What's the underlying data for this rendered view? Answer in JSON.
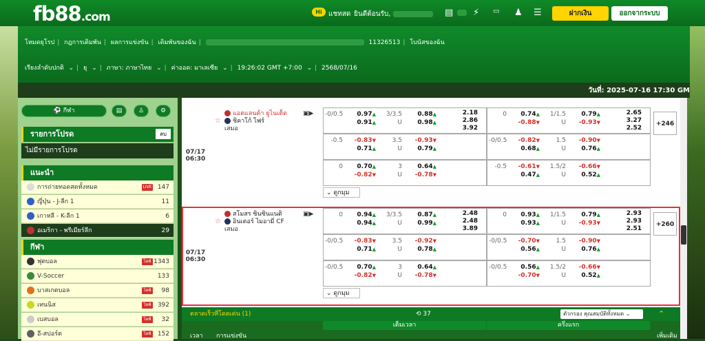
{
  "topbar": {
    "logo_main": "fb88",
    "logo_suffix": ".com",
    "hi_badge": "Hi",
    "chat_label": "แชทสด",
    "welcome_label": "ยินดีต้อนรับ,",
    "deposit_button": "ฝากเงิน",
    "logout_button": "ออกจากระบบ"
  },
  "menu": {
    "row1": [
      "โหมดยุโรป",
      "กฎการเดิมพัน",
      "ผลการแข่งขัน",
      "เดิมพันของฉัน"
    ],
    "account_id": "11326513",
    "bonus_label": "โบนัสของฉัน",
    "sort_label": "เรียงลำดับปกติ",
    "odds_type": "ยุ",
    "language": "ภาษา: ภาษาไทย",
    "odds_format": "ค่าออด: มาเลเซีย",
    "timezone": "19:26:02 GMT +7:00",
    "date": "2568/07/16"
  },
  "datetime": "วันที่: 2025-07-16 17:30 GM",
  "sidebar": {
    "sports_button": "กีฬา",
    "favorites_title": "รายการโปรด",
    "favorites_btn": "ลบ",
    "no_favorites": "ไม่มีรายการโปรด",
    "recommended_title": "แนะนำ",
    "recommended": [
      {
        "label": "การถ่ายทอดสดทั้งหมด",
        "count": "147",
        "live": "LIVE",
        "color": "#dddddd"
      },
      {
        "label": "ญี่ปุ่น - J-ลีก 1",
        "count": "11",
        "color": "#3060c0"
      },
      {
        "label": "เกาหลี - K-ลีก 1",
        "count": "6",
        "color": "#3060c0"
      },
      {
        "label": "อเมริกา - พรีเมียร์ลีก",
        "count": "29",
        "color": "#c03030",
        "selected": true
      }
    ],
    "sports_title": "กีฬา",
    "sports": [
      {
        "label": "ฟุตบอล",
        "count": "1343",
        "live": "ไลฟ์",
        "color": "#333333"
      },
      {
        "label": "V-Soccer",
        "count": "133",
        "color": "#3a8a3a"
      },
      {
        "label": "บาสเกตบอล",
        "count": "98",
        "live": "ไลฟ์",
        "color": "#e07020"
      },
      {
        "label": "เทนนิส",
        "count": "392",
        "live": "ไลฟ์",
        "color": "#c8d820"
      },
      {
        "label": "เบสบอล",
        "count": "32",
        "live": "ไลฟ์",
        "color": "#cccccc"
      },
      {
        "label": "อี-สปอร์ต",
        "count": "152",
        "live": "ไลฟ์",
        "color": "#606060"
      }
    ]
  },
  "matches": [
    {
      "date": "07/17",
      "time": "06:30",
      "home": "แอตแลนต้า ยูไนเต็ด",
      "away": "ชิคาโก้ ไฟร์",
      "draw": "เสมอ",
      "more": "+246",
      "more_label": "ดูกมุม",
      "rows": [
        {
          "h_hdp": "-0/0.5",
          "h_o1": "0.97",
          "h_o2": "0.91",
          "ou_line": "3/3.5",
          "ou_u": "U",
          "ou_o1": "0.88",
          "ou_o2": "0.98",
          "x12": [
            "2.18",
            "2.86",
            "3.92"
          ],
          "f_hdp": "0",
          "f_o1": "0.74",
          "f_o2": "-0.88",
          "fou_line": "1/1.5",
          "fou_u": "U",
          "fou_o1": "0.79",
          "fou_o2": "-0.93",
          "fx12": [
            "2.65",
            "3.27",
            "2.52"
          ]
        },
        {
          "h_hdp": "-0.5",
          "h_o1": "-0.83",
          "h_o2": "0.71",
          "ou_line": "3.5",
          "ou_u": "U",
          "ou_o1": "-0.93",
          "ou_o2": "0.79",
          "f_hdp": "-0/0.5",
          "f_o1": "-0.82",
          "f_o2": "0.68",
          "fou_line": "1.5",
          "fou_u": "U",
          "fou_o1": "-0.90",
          "fou_o2": "0.76"
        },
        {
          "h_hdp": "0",
          "h_o1": "0.70",
          "h_o2": "-0.82",
          "ou_line": "3",
          "ou_u": "U",
          "ou_o1": "0.64",
          "ou_o2": "-0.78",
          "f_hdp": "-0.5",
          "f_o1": "-0.61",
          "f_o2": "0.47",
          "fou_line": "1.5/2",
          "fou_u": "U",
          "fou_o1": "-0.66",
          "fou_o2": "0.52"
        }
      ]
    },
    {
      "date": "07/17",
      "time": "06:30",
      "home": "สโมสร ซินซินแนติ",
      "away": "อินเตอร์ ไมอามี่ CF",
      "draw": "เสมอ",
      "more": "+260",
      "more_label": "ดูกมุม",
      "rows": [
        {
          "h_hdp": "0",
          "h_o1": "0.94",
          "h_o2": "0.94",
          "ou_line": "3/3.5",
          "ou_u": "U",
          "ou_o1": "0.87",
          "ou_o2": "0.99",
          "x12": [
            "2.48",
            "2.48",
            "3.89"
          ],
          "f_hdp": "0",
          "f_o1": "0.93",
          "f_o2": "0.93",
          "fou_line": "1/1.5",
          "fou_u": "U",
          "fou_o1": "0.79",
          "fou_o2": "-0.93",
          "fx12": [
            "2.93",
            "2.93",
            "2.51"
          ]
        },
        {
          "h_hdp": "-0/0.5",
          "h_o1": "-0.83",
          "h_o2": "0.71",
          "ou_line": "3.5",
          "ou_u": "U",
          "ou_o1": "-0.92",
          "ou_o2": "0.78",
          "f_hdp": "-0/0.5",
          "f_o1": "-0.70",
          "f_o2": "0.56",
          "fou_line": "1.5",
          "fou_u": "U",
          "fou_o1": "-0.90",
          "fou_o2": "0.76"
        },
        {
          "h_hdp": "-0/0.5",
          "h_o1": "0.70",
          "h_o2": "-0.82",
          "ou_line": "3",
          "ou_u": "U",
          "ou_o1": "0.64",
          "ou_o2": "-0.78",
          "f_hdp": "-0/0.5",
          "f_o1": "0.56",
          "f_o2": "-0.70",
          "fou_line": "1.5/2",
          "fou_u": "U",
          "fou_o1": "-0.66",
          "fou_o2": "0.52"
        }
      ]
    }
  ],
  "footer": {
    "title": "ตลาดเร็วที่โดดเด่น (1)",
    "count": "37",
    "filter": "ตัวกรอง คุณสมบัติทั้งหมด",
    "col_time": "เวลา",
    "col_event": "การแข่งขัน",
    "col_full": "เต็มเวลา",
    "col_half": "ครึ่งแรก",
    "col_more": "เพิ่มเติม"
  }
}
